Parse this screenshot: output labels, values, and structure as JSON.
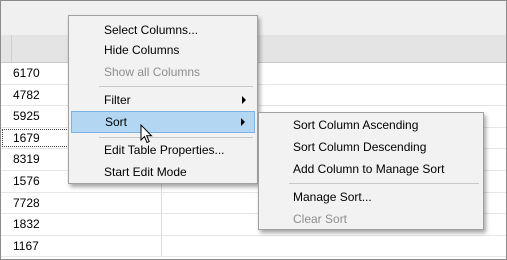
{
  "table": {
    "rows": [
      "6170",
      "4782",
      "5925",
      "1679",
      "8319",
      "1576",
      "7728",
      "1832",
      "1167"
    ],
    "focused_row": 3
  },
  "context_menu": {
    "items": [
      {
        "label": "Select Columns...",
        "disabled": false
      },
      {
        "label": "Hide Columns",
        "disabled": false
      },
      {
        "label": "Show all Columns",
        "disabled": true
      },
      {
        "label": "Filter",
        "has_submenu": true
      },
      {
        "label": "Sort",
        "has_submenu": true,
        "highlighted": true
      },
      {
        "label": "Edit Table Properties..."
      },
      {
        "label": "Start Edit Mode"
      }
    ]
  },
  "sort_submenu": {
    "items": [
      {
        "label": "Sort Column Ascending"
      },
      {
        "label": "Sort Column Descending"
      },
      {
        "label": "Add Column to Manage Sort"
      },
      {
        "label": "Manage Sort..."
      },
      {
        "label": "Clear Sort",
        "disabled": true
      }
    ]
  },
  "colors": {
    "highlight": "#b3d7f3",
    "highlight_border": "#7ab3e6",
    "disabled_text": "#8d8d8d",
    "menu_bg": "#f2f2f2"
  }
}
